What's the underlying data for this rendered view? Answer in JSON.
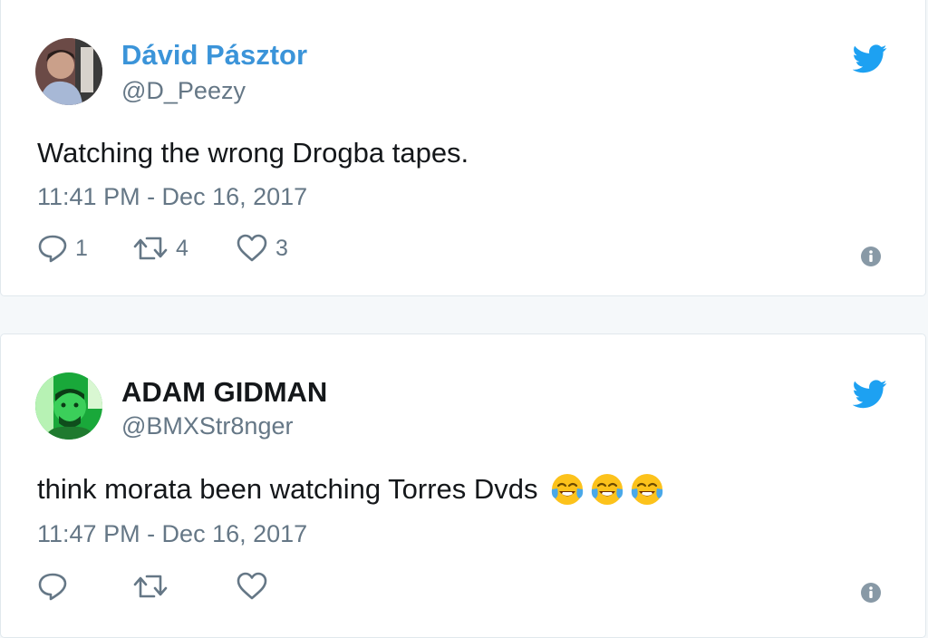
{
  "tweets": [
    {
      "display_name": "Dávid Pásztor",
      "handle": "@D_Peezy",
      "text": "Watching the wrong Drogba tapes.",
      "timestamp": "11:41 PM - Dec 16, 2017",
      "reply_count": "1",
      "retweet_count": "4",
      "like_count": "3",
      "name_color": "#3b94d9"
    },
    {
      "display_name": "ADAM GIDMAN",
      "handle": "@BMXStr8nger",
      "text": "think morata been watching Torres Dvds",
      "emoji": [
        "face-with-tears-of-joy",
        "face-with-tears-of-joy",
        "face-with-tears-of-joy"
      ],
      "timestamp": "11:47 PM - Dec 16, 2017",
      "reply_count": "",
      "retweet_count": "",
      "like_count": "",
      "name_color": "#14171a"
    }
  ],
  "icons": {
    "brand": "twitter-bird-icon",
    "reply": "reply-icon",
    "retweet": "retweet-icon",
    "like": "heart-icon",
    "info": "info-icon"
  },
  "colors": {
    "twitter_blue": "#1da1f2",
    "secondary_text": "#657786",
    "primary_text": "#14171a",
    "border": "#e1e8ed"
  }
}
